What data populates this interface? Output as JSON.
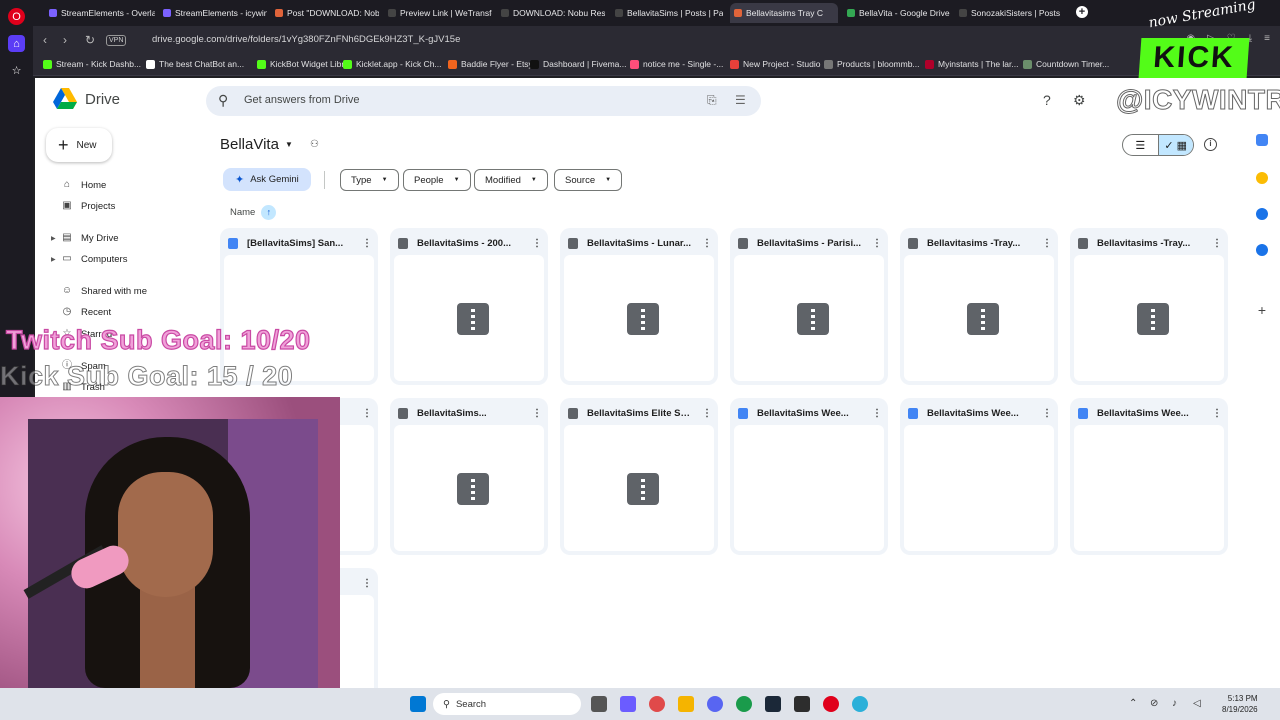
{
  "browser": {
    "tabs": [
      {
        "label": "StreamElements - Overlay",
        "color": "#7b61ff"
      },
      {
        "label": "StreamElements - icywintr",
        "color": "#7b61ff"
      },
      {
        "label": "Post \"DOWNLOAD: Nobu",
        "color": "#e0643a"
      },
      {
        "label": "Preview Link | WeTransfer",
        "color": "#444444"
      },
      {
        "label": "DOWNLOAD: Nobu Resta",
        "color": "#444444"
      },
      {
        "label": "BellavitaSims | Posts | Patr",
        "color": "#444444"
      },
      {
        "label": "Bellavitasims Tray C",
        "color": "#e0643a"
      },
      {
        "label": "BellaVita - Google Drive",
        "color": "#34a853"
      },
      {
        "label": "SonozakiSisters | Posts | P",
        "color": "#444444"
      }
    ],
    "active_tab_index": 6,
    "url": "drive.google.com/drive/folders/1vYg380FZnFNh6DGEk9HZ3T_K-gJV15e",
    "vpn_label": "VPN",
    "bookmarks": [
      {
        "label": "Stream - Kick Dashb...",
        "color": "#53fc18"
      },
      {
        "label": "The best ChatBot an...",
        "color": "#ffffff"
      },
      {
        "label": "KickBot Widget Libr...",
        "color": "#53fc18"
      },
      {
        "label": "Kicklet.app - Kick Ch...",
        "color": "#53fc18"
      },
      {
        "label": "Baddie Flyer - Etsy",
        "color": "#f1641e"
      },
      {
        "label": "Dashboard | Fivema...",
        "color": "#111111"
      },
      {
        "label": "notice me - Single -...",
        "color": "#ff4e7a"
      },
      {
        "label": "New Project - Studio",
        "color": "#e8403a"
      },
      {
        "label": "Products | bloommb...",
        "color": "#777777"
      },
      {
        "label": "Myinstants | The lar...",
        "color": "#b0002a"
      },
      {
        "label": "Countdown Timer...",
        "color": "#6b8e6b"
      }
    ]
  },
  "drive": {
    "app_name": "Drive",
    "search_placeholder": "Get answers from Drive",
    "new_label": "New",
    "nav": [
      {
        "label": "Home",
        "icon": "home-icon",
        "glyph": "⌂"
      },
      {
        "label": "Projects",
        "icon": "projects-icon",
        "glyph": "▣"
      },
      {
        "label": "My Drive",
        "icon": "my-drive-icon",
        "glyph": "▤"
      },
      {
        "label": "Computers",
        "icon": "computers-icon",
        "glyph": "▭"
      },
      {
        "label": "Shared with me",
        "icon": "shared-icon",
        "glyph": "☺"
      },
      {
        "label": "Recent",
        "icon": "recent-icon",
        "glyph": "◷"
      },
      {
        "label": "Starred",
        "icon": "star-icon",
        "glyph": "☆"
      },
      {
        "label": "Spam",
        "icon": "spam-icon",
        "glyph": "ⓘ"
      },
      {
        "label": "Trash",
        "icon": "trash-icon",
        "glyph": "▥"
      }
    ],
    "folder_title": "BellaVita",
    "ask_gemini": "Ask Gemini",
    "filters": [
      "Type",
      "People",
      "Modified",
      "Source"
    ],
    "sort_label": "Name",
    "files": [
      {
        "name": "[BellavitaSims] San...",
        "type": "doc",
        "thumb": "blank"
      },
      {
        "name": "BellavitaSims - 200...",
        "type": "zip",
        "thumb": "zip"
      },
      {
        "name": "BellavitaSims - Lunar...",
        "type": "zip",
        "thumb": "zip"
      },
      {
        "name": "BellavitaSims - Parisi...",
        "type": "zip",
        "thumb": "zip"
      },
      {
        "name": "Bellavitasims -Tray...",
        "type": "zip",
        "thumb": "zip"
      },
      {
        "name": "Bellavitasims -Tray...",
        "type": "zip",
        "thumb": "zip"
      },
      {
        "name": "",
        "type": "zip",
        "thumb": "blank"
      },
      {
        "name": "BellavitaSims...",
        "type": "zip",
        "thumb": "zip"
      },
      {
        "name": "BellavitaSims Elite Sk...",
        "type": "zip",
        "thumb": "zip"
      },
      {
        "name": "BellavitaSims Wee...",
        "type": "doc",
        "thumb": "blank"
      },
      {
        "name": "BellavitaSims Wee...",
        "type": "doc",
        "thumb": "blank"
      },
      {
        "name": "BellavitaSims Wee...",
        "type": "doc",
        "thumb": "blank"
      },
      {
        "name": "t...",
        "type": "doc",
        "thumb": "blank"
      }
    ]
  },
  "overlay": {
    "twitch_goal": "Twitch Sub Goal: 10/20",
    "kick_goal": "Kick Sub Goal: 15 / 20",
    "now_streaming": "now Streaming",
    "kick_logo": "KICK",
    "handle": "@ICYWINTRR",
    "kick_color": "#53fc18"
  },
  "taskbar": {
    "search_label": "Search",
    "time": "5:13 PM",
    "date": "8/19/2026"
  }
}
